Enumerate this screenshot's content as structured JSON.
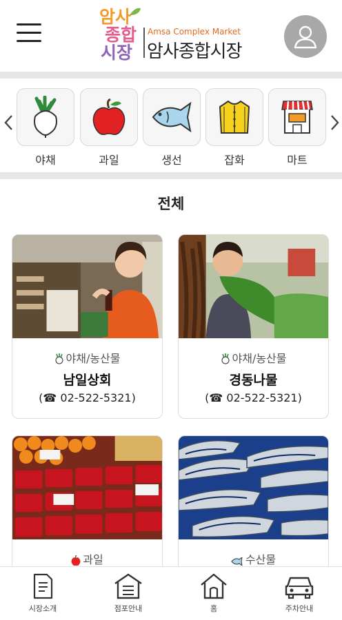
{
  "header": {
    "logo_mark": [
      "암사",
      "종합",
      "시장"
    ],
    "logo_en": "Amsa Complex Market",
    "logo_ko": "암사종합시장",
    "colors": {
      "accent": "#e36a1c",
      "brand_green": "#7ab648",
      "brand_pink": "#e75a8c",
      "brand_purple": "#8f63b8",
      "brand_orange": "#f29b2a"
    }
  },
  "categories": [
    {
      "label": "야채",
      "icon": "radish-icon"
    },
    {
      "label": "과일",
      "icon": "apple-icon"
    },
    {
      "label": "생선",
      "icon": "fish-icon"
    },
    {
      "label": "잡화",
      "icon": "shirt-icon"
    },
    {
      "label": "마트",
      "icon": "store-icon"
    }
  ],
  "section": {
    "title": "전체"
  },
  "stores": [
    {
      "category": "야채/농산물",
      "category_icon": "radish-icon",
      "name": "남일상회",
      "phone": "(☎ 02-522-5321)"
    },
    {
      "category": "야채/농산물",
      "category_icon": "radish-icon",
      "name": "경동나물",
      "phone": "(☎ 02-522-5321)"
    },
    {
      "category": "과일",
      "category_icon": "apple-icon"
    },
    {
      "category": "수산물",
      "category_icon": "fish-icon"
    }
  ],
  "bottom_nav": [
    {
      "label": "시장소개",
      "icon": "document-icon"
    },
    {
      "label": "점포안내",
      "icon": "store-list-icon"
    },
    {
      "label": "홈",
      "icon": "home-icon"
    },
    {
      "label": "주차안내",
      "icon": "car-icon"
    }
  ]
}
